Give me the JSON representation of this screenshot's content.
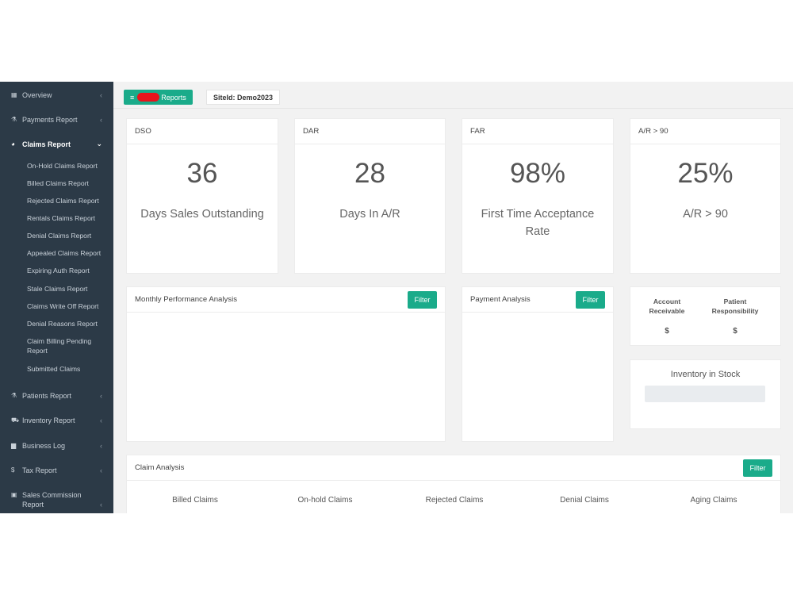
{
  "sidebar": {
    "items": [
      {
        "label": "Overview",
        "icon": "grid-icon"
      },
      {
        "label": "Payments Report",
        "icon": "flask-icon"
      },
      {
        "label": "Claims Report",
        "icon": "pie-chart-icon"
      },
      {
        "label": "Patients Report",
        "icon": "flask-icon"
      },
      {
        "label": "Inventory Report",
        "icon": "cart-icon"
      },
      {
        "label": "Business Log",
        "icon": "book-icon"
      },
      {
        "label": "Tax Report",
        "icon": "dollar-icon"
      },
      {
        "label": "Sales Commission Report",
        "icon": "money-icon"
      }
    ],
    "claims_sub": [
      "On-Hold Claims Report",
      "Billed Claims Report",
      "Rejected Claims Report",
      "Rentals Claims Report",
      "Denial Claims Report",
      "Appealed Claims Report",
      "Expiring Auth Report",
      "Stale Claims Report",
      "Claims Write Off Report",
      "Denial Reasons Report",
      "Claim Billing Pending Report",
      "Submitted Claims"
    ]
  },
  "topbar": {
    "reports_label": "Reports",
    "site_label": "SiteId: Demo2023"
  },
  "kpis": [
    {
      "title": "DSO",
      "value": "36",
      "label": "Days Sales Outstanding"
    },
    {
      "title": "DAR",
      "value": "28",
      "label": "Days In A/R"
    },
    {
      "title": "FAR",
      "value": "98%",
      "label": "First Time Acceptance Rate"
    },
    {
      "title": "A/R > 90",
      "value": "25%",
      "label": "A/R > 90"
    }
  ],
  "monthly": {
    "title": "Monthly Performance Analysis",
    "filter": "Filter"
  },
  "payment": {
    "title": "Payment Analysis",
    "filter": "Filter"
  },
  "account": {
    "receivable_label": "Account Receivable",
    "receivable_value": "$",
    "patient_label": "Patient Responsibility",
    "patient_value": "$"
  },
  "inventory": {
    "title": "Inventory in Stock"
  },
  "claim_analysis": {
    "title": "Claim Analysis",
    "filter": "Filter",
    "columns": [
      "Billed Claims",
      "On-hold Claims",
      "Rejected Claims",
      "Denial Claims",
      "Aging Claims"
    ]
  },
  "colors": {
    "accent": "#1aab8a",
    "sidebar": "#2c3a47",
    "redaction": "#e8141c"
  }
}
